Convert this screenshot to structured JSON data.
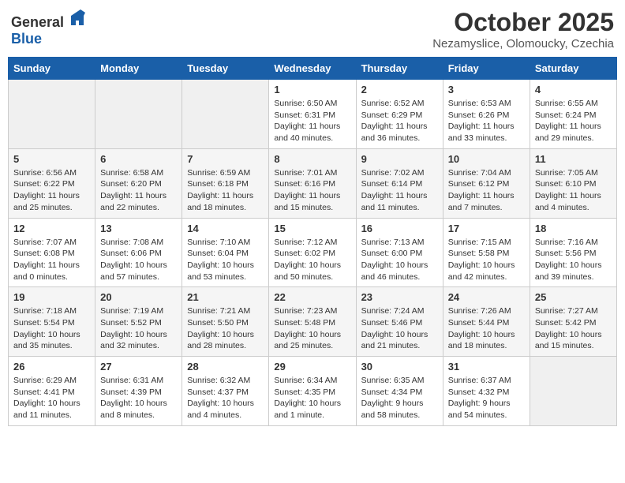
{
  "header": {
    "logo_general": "General",
    "logo_blue": "Blue",
    "month": "October 2025",
    "location": "Nezamyslice, Olomoucky, Czechia"
  },
  "weekdays": [
    "Sunday",
    "Monday",
    "Tuesday",
    "Wednesday",
    "Thursday",
    "Friday",
    "Saturday"
  ],
  "weeks": [
    [
      {
        "day": "",
        "info": ""
      },
      {
        "day": "",
        "info": ""
      },
      {
        "day": "",
        "info": ""
      },
      {
        "day": "1",
        "info": "Sunrise: 6:50 AM\nSunset: 6:31 PM\nDaylight: 11 hours\nand 40 minutes."
      },
      {
        "day": "2",
        "info": "Sunrise: 6:52 AM\nSunset: 6:29 PM\nDaylight: 11 hours\nand 36 minutes."
      },
      {
        "day": "3",
        "info": "Sunrise: 6:53 AM\nSunset: 6:26 PM\nDaylight: 11 hours\nand 33 minutes."
      },
      {
        "day": "4",
        "info": "Sunrise: 6:55 AM\nSunset: 6:24 PM\nDaylight: 11 hours\nand 29 minutes."
      }
    ],
    [
      {
        "day": "5",
        "info": "Sunrise: 6:56 AM\nSunset: 6:22 PM\nDaylight: 11 hours\nand 25 minutes."
      },
      {
        "day": "6",
        "info": "Sunrise: 6:58 AM\nSunset: 6:20 PM\nDaylight: 11 hours\nand 22 minutes."
      },
      {
        "day": "7",
        "info": "Sunrise: 6:59 AM\nSunset: 6:18 PM\nDaylight: 11 hours\nand 18 minutes."
      },
      {
        "day": "8",
        "info": "Sunrise: 7:01 AM\nSunset: 6:16 PM\nDaylight: 11 hours\nand 15 minutes."
      },
      {
        "day": "9",
        "info": "Sunrise: 7:02 AM\nSunset: 6:14 PM\nDaylight: 11 hours\nand 11 minutes."
      },
      {
        "day": "10",
        "info": "Sunrise: 7:04 AM\nSunset: 6:12 PM\nDaylight: 11 hours\nand 7 minutes."
      },
      {
        "day": "11",
        "info": "Sunrise: 7:05 AM\nSunset: 6:10 PM\nDaylight: 11 hours\nand 4 minutes."
      }
    ],
    [
      {
        "day": "12",
        "info": "Sunrise: 7:07 AM\nSunset: 6:08 PM\nDaylight: 11 hours\nand 0 minutes."
      },
      {
        "day": "13",
        "info": "Sunrise: 7:08 AM\nSunset: 6:06 PM\nDaylight: 10 hours\nand 57 minutes."
      },
      {
        "day": "14",
        "info": "Sunrise: 7:10 AM\nSunset: 6:04 PM\nDaylight: 10 hours\nand 53 minutes."
      },
      {
        "day": "15",
        "info": "Sunrise: 7:12 AM\nSunset: 6:02 PM\nDaylight: 10 hours\nand 50 minutes."
      },
      {
        "day": "16",
        "info": "Sunrise: 7:13 AM\nSunset: 6:00 PM\nDaylight: 10 hours\nand 46 minutes."
      },
      {
        "day": "17",
        "info": "Sunrise: 7:15 AM\nSunset: 5:58 PM\nDaylight: 10 hours\nand 42 minutes."
      },
      {
        "day": "18",
        "info": "Sunrise: 7:16 AM\nSunset: 5:56 PM\nDaylight: 10 hours\nand 39 minutes."
      }
    ],
    [
      {
        "day": "19",
        "info": "Sunrise: 7:18 AM\nSunset: 5:54 PM\nDaylight: 10 hours\nand 35 minutes."
      },
      {
        "day": "20",
        "info": "Sunrise: 7:19 AM\nSunset: 5:52 PM\nDaylight: 10 hours\nand 32 minutes."
      },
      {
        "day": "21",
        "info": "Sunrise: 7:21 AM\nSunset: 5:50 PM\nDaylight: 10 hours\nand 28 minutes."
      },
      {
        "day": "22",
        "info": "Sunrise: 7:23 AM\nSunset: 5:48 PM\nDaylight: 10 hours\nand 25 minutes."
      },
      {
        "day": "23",
        "info": "Sunrise: 7:24 AM\nSunset: 5:46 PM\nDaylight: 10 hours\nand 21 minutes."
      },
      {
        "day": "24",
        "info": "Sunrise: 7:26 AM\nSunset: 5:44 PM\nDaylight: 10 hours\nand 18 minutes."
      },
      {
        "day": "25",
        "info": "Sunrise: 7:27 AM\nSunset: 5:42 PM\nDaylight: 10 hours\nand 15 minutes."
      }
    ],
    [
      {
        "day": "26",
        "info": "Sunrise: 6:29 AM\nSunset: 4:41 PM\nDaylight: 10 hours\nand 11 minutes."
      },
      {
        "day": "27",
        "info": "Sunrise: 6:31 AM\nSunset: 4:39 PM\nDaylight: 10 hours\nand 8 minutes."
      },
      {
        "day": "28",
        "info": "Sunrise: 6:32 AM\nSunset: 4:37 PM\nDaylight: 10 hours\nand 4 minutes."
      },
      {
        "day": "29",
        "info": "Sunrise: 6:34 AM\nSunset: 4:35 PM\nDaylight: 10 hours\nand 1 minute."
      },
      {
        "day": "30",
        "info": "Sunrise: 6:35 AM\nSunset: 4:34 PM\nDaylight: 9 hours\nand 58 minutes."
      },
      {
        "day": "31",
        "info": "Sunrise: 6:37 AM\nSunset: 4:32 PM\nDaylight: 9 hours\nand 54 minutes."
      },
      {
        "day": "",
        "info": ""
      }
    ]
  ]
}
